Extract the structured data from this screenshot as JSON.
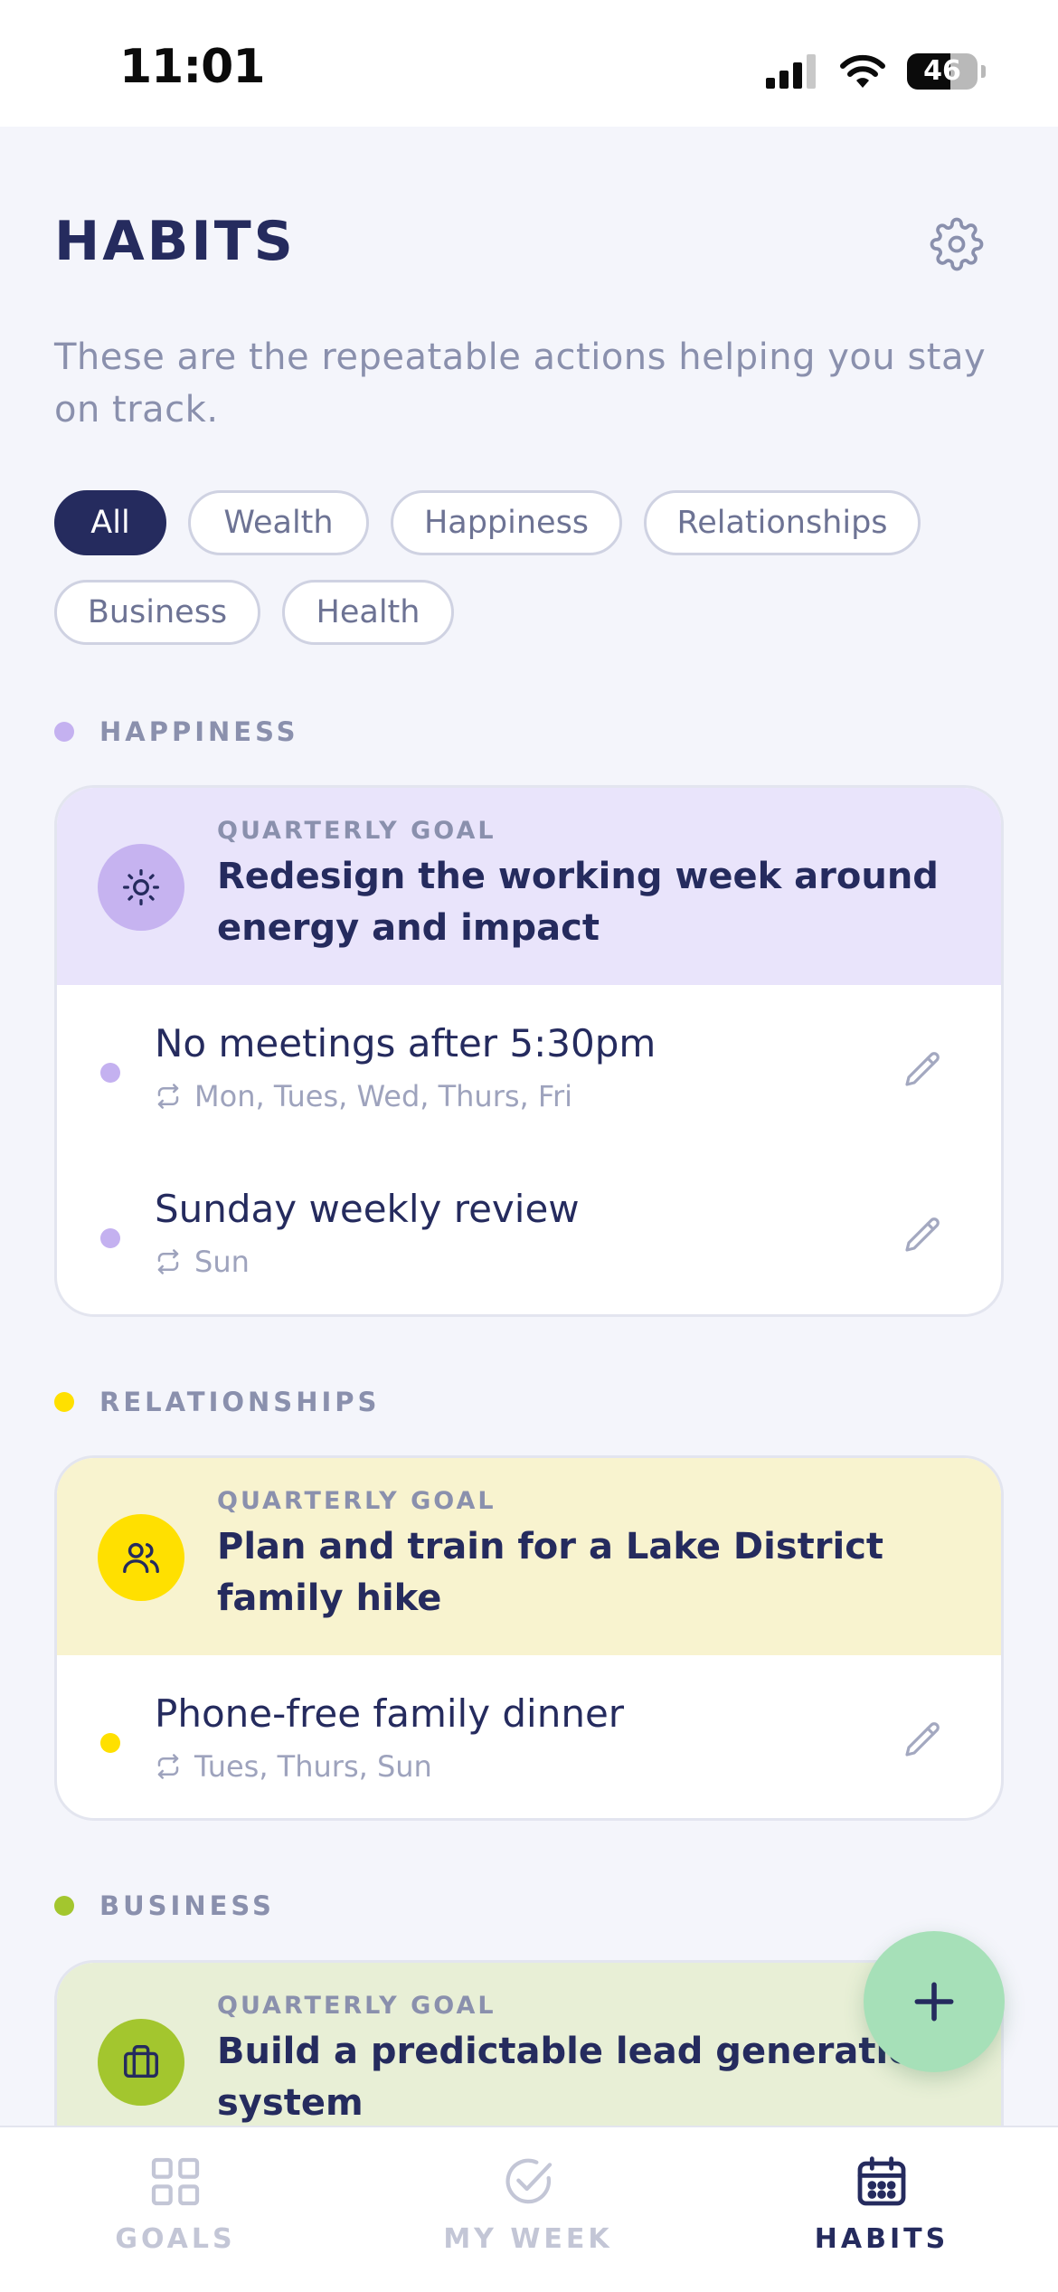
{
  "status_bar": {
    "time": "11:01",
    "battery": "46"
  },
  "header": {
    "title": "HABITS",
    "settings_icon": "gear-icon"
  },
  "subtitle": "These are the repeatable actions helping you stay on track.",
  "filters": {
    "chips": [
      "All",
      "Wealth",
      "Happiness",
      "Relationships",
      "Business",
      "Health"
    ],
    "selected": "All"
  },
  "sections": [
    {
      "label": "HAPPINESS",
      "color": "#c4b1f0",
      "goal": {
        "kicker": "QUARTERLY GOAL",
        "title": "Redesign the working week around energy and impact",
        "icon": "sun-icon",
        "bg": "#e9e4fb",
        "icon_bg": "#c6b3f0"
      },
      "habits": [
        {
          "name": "No meetings after 5:30pm",
          "days": "Mon, Tues, Wed, Thurs, Fri"
        },
        {
          "name": "Sunday weekly review",
          "days": "Sun"
        }
      ]
    },
    {
      "label": "RELATIONSHIPS",
      "color": "#ffe000",
      "goal": {
        "kicker": "QUARTERLY GOAL",
        "title": "Plan and train for a Lake District family hike",
        "icon": "people-icon",
        "bg": "#f8f3cf",
        "icon_bg": "#ffe000"
      },
      "habits": [
        {
          "name": "Phone-free family dinner",
          "days": "Tues, Thurs, Sun"
        }
      ]
    },
    {
      "label": "BUSINESS",
      "color": "#a3c62e",
      "goal": {
        "kicker": "QUARTERLY GOAL",
        "title": "Build a predictable lead generation system",
        "icon": "briefcase-icon",
        "bg": "#e8efd6",
        "icon_bg": "#a3c62e"
      },
      "habits": []
    }
  ],
  "fab": {
    "icon": "plus-icon"
  },
  "tabs": [
    {
      "label": "GOALS",
      "icon": "grid-icon",
      "active": false
    },
    {
      "label": "MY WEEK",
      "icon": "check-circle-icon",
      "active": false
    },
    {
      "label": "HABITS",
      "icon": "calendar-icon",
      "active": true
    }
  ]
}
